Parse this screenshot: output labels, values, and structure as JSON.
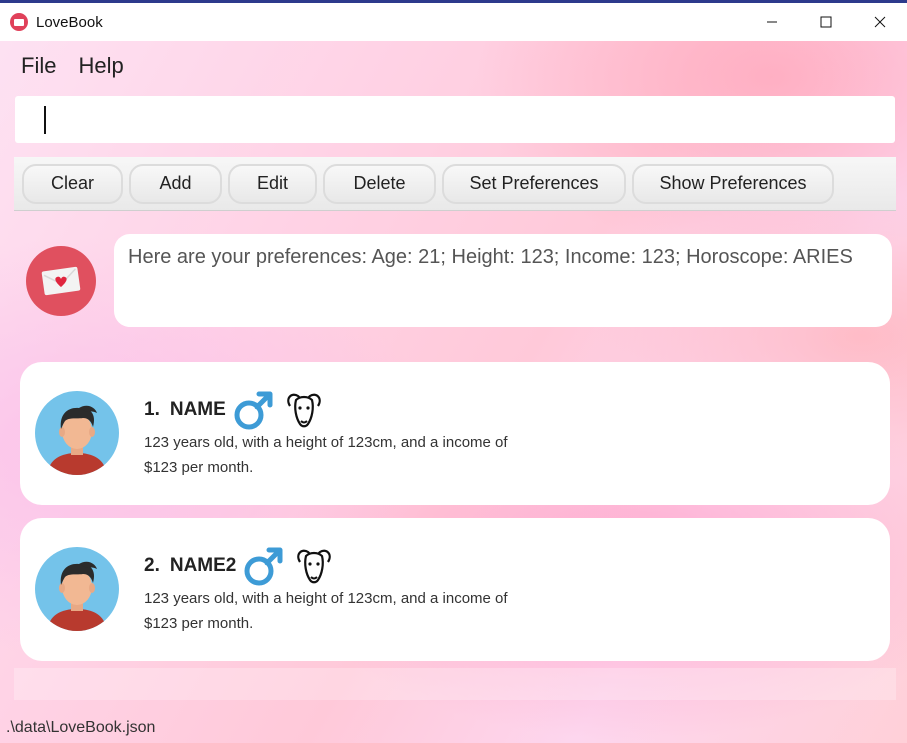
{
  "window": {
    "title": "LoveBook"
  },
  "menu": {
    "items": [
      {
        "label": "File"
      },
      {
        "label": "Help"
      }
    ]
  },
  "command": {
    "value": "",
    "placeholder": ""
  },
  "toolbar": {
    "buttons": [
      {
        "label": "Clear"
      },
      {
        "label": "Add"
      },
      {
        "label": "Edit"
      },
      {
        "label": "Delete"
      },
      {
        "label": "Set Preferences"
      },
      {
        "label": "Show Preferences"
      }
    ]
  },
  "response": {
    "icon": "envelope-heart-icon",
    "text": "Here are your preferences: Age: 21; Height: 123; Income: 123; Horoscope: ARIES"
  },
  "people": [
    {
      "index": "1.",
      "name": "NAME",
      "gender_icon": "male-symbol-icon",
      "horoscope_icon": "aries-ram-icon",
      "description": "123 years old, with a height of 123cm, and a income of $123 per month."
    },
    {
      "index": "2.",
      "name": "NAME2",
      "gender_icon": "male-symbol-icon",
      "horoscope_icon": "aries-ram-icon",
      "description": "123 years old, with a height of 123cm, and a income of $123 per month."
    }
  ],
  "status": {
    "file_path": ".\\data\\LoveBook.json"
  },
  "colors": {
    "accent": "#e0415a",
    "gender_blue": "#3d9bd6",
    "title_border": "#2d3a8c"
  }
}
